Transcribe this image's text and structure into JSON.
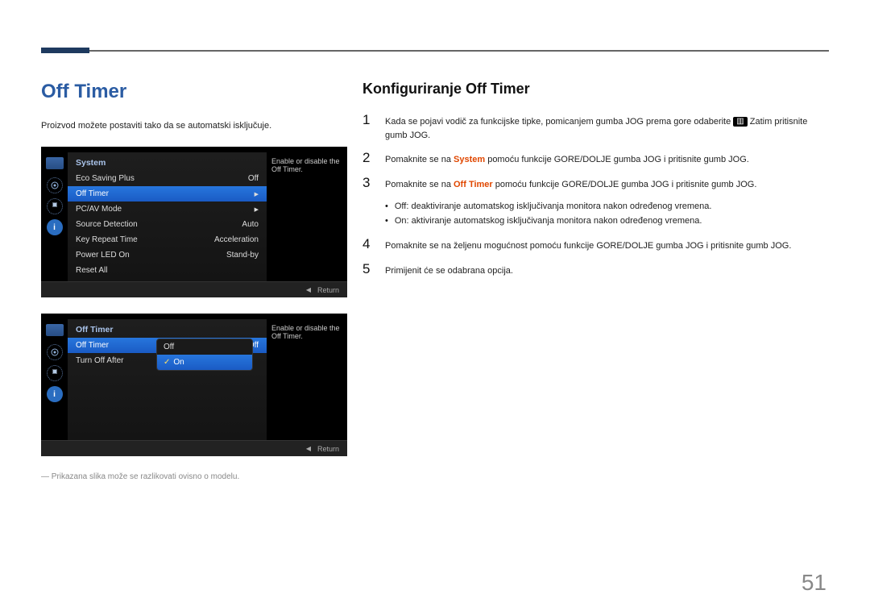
{
  "page": {
    "title": "Off Timer",
    "intro": "Proizvod možete postaviti tako da se automatski isključuje.",
    "note": "― Prikazana slika može se razlikovati ovisno o modelu.",
    "pageNumber": "51"
  },
  "osd1": {
    "title": "System",
    "tooltip": "Enable or disable the Off Timer.",
    "rows": [
      {
        "label": "Eco Saving Plus",
        "value": "Off"
      },
      {
        "label": "Off Timer",
        "value": "▶",
        "selected": true
      },
      {
        "label": "PC/AV Mode",
        "value": "▶"
      },
      {
        "label": "Source Detection",
        "value": "Auto"
      },
      {
        "label": "Key Repeat Time",
        "value": "Acceleration"
      },
      {
        "label": "Power LED On",
        "value": "Stand-by"
      },
      {
        "label": "Reset All",
        "value": ""
      }
    ],
    "return": "Return"
  },
  "osd2": {
    "title": "Off Timer",
    "tooltip": "Enable or disable the Off Timer.",
    "rows": [
      {
        "label": "Off Timer",
        "value": "Off",
        "selected": true
      },
      {
        "label": "Turn Off After",
        "value": ""
      }
    ],
    "subOptions": [
      "Off",
      "On"
    ],
    "subSelected": "On",
    "return": "Return"
  },
  "right": {
    "section_title": "Konfiguriranje Off Timer",
    "steps": {
      "s1a": "Kada se pojavi vodič za funkcijske tipke, pomicanjem gumba JOG prema gore odaberite ",
      "s1b": " Zatim pritisnite gumb JOG.",
      "s2a": "Pomaknite se na ",
      "s2hi": "System",
      "s2b": " pomoću funkcije GORE/DOLJE gumba JOG i pritisnite gumb JOG.",
      "s3a": "Pomaknite se na ",
      "s3hi": "Off Timer",
      "s3b": " pomoću funkcije GORE/DOLJE gumba JOG i pritisnite gumb JOG.",
      "b1hi": "Off",
      "b1": ": deaktiviranje automatskog isključivanja monitora nakon određenog vremena.",
      "b2hi": "On",
      "b2": ": aktiviranje automatskog isključivanja monitora nakon određenog vremena.",
      "s4": "Pomaknite se na željenu mogućnost pomoću funkcije GORE/DOLJE gumba JOG i pritisnite gumb JOG.",
      "s5": "Primijenit će se odabrana opcija."
    }
  },
  "icons": {
    "menu_icon": "▥"
  }
}
